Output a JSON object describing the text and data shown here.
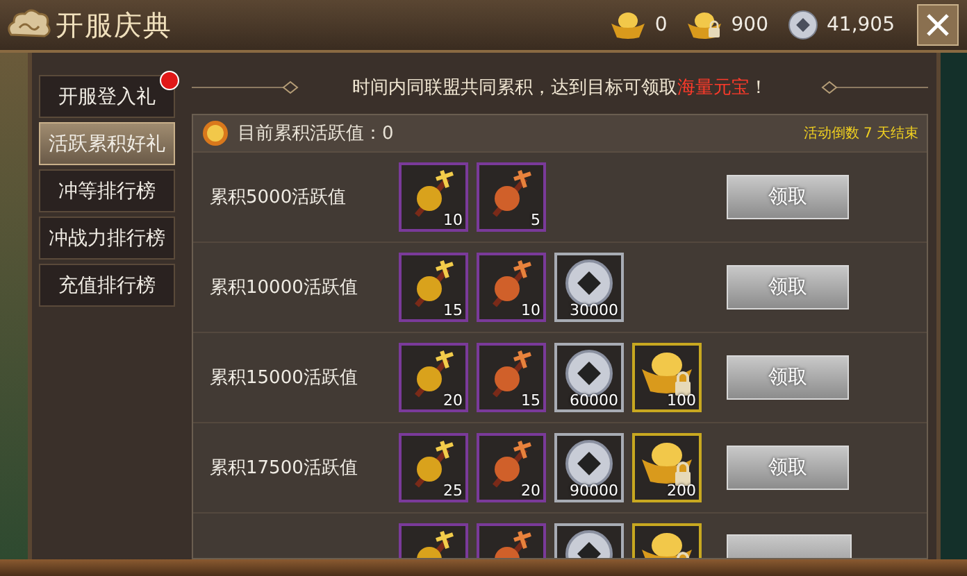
{
  "window": {
    "title": "开服庆典"
  },
  "currencies": [
    {
      "kind": "ingot",
      "amount": "0"
    },
    {
      "kind": "lockedingot",
      "amount": "900"
    },
    {
      "kind": "coin",
      "amount": "41,905"
    }
  ],
  "tabs": [
    {
      "label": "开服登入礼",
      "selected": false,
      "badge": true
    },
    {
      "label": "活跃累积好礼",
      "selected": true,
      "badge": false
    },
    {
      "label": "冲等排行榜",
      "selected": false,
      "badge": false
    },
    {
      "label": "冲战力排行榜",
      "selected": false,
      "badge": false
    },
    {
      "label": "充值排行榜",
      "selected": false,
      "badge": false
    }
  ],
  "banner": {
    "text": "时间内同联盟共同累积，达到目标可领取",
    "highlight": "海量元宝",
    "suffix": "！"
  },
  "progress": {
    "label": "目前累积活跃值：0",
    "countdown": "活动倒数 7 天结束"
  },
  "rows": [
    {
      "label": "累积5000活跃值",
      "rewards": [
        {
          "kind": "scroll",
          "count": "10"
        },
        {
          "kind": "talisman",
          "count": "5"
        }
      ],
      "button": "领取"
    },
    {
      "label": "累积10000活跃值",
      "rewards": [
        {
          "kind": "scroll",
          "count": "15"
        },
        {
          "kind": "talisman",
          "count": "10"
        },
        {
          "kind": "coin",
          "count": "30000"
        }
      ],
      "button": "领取"
    },
    {
      "label": "累积15000活跃值",
      "rewards": [
        {
          "kind": "scroll",
          "count": "20"
        },
        {
          "kind": "talisman",
          "count": "15"
        },
        {
          "kind": "coin",
          "count": "60000"
        },
        {
          "kind": "lockedingot",
          "count": "100"
        }
      ],
      "button": "领取"
    },
    {
      "label": "累积17500活跃值",
      "rewards": [
        {
          "kind": "scroll",
          "count": "25"
        },
        {
          "kind": "talisman",
          "count": "20"
        },
        {
          "kind": "coin",
          "count": "90000"
        },
        {
          "kind": "lockedingot",
          "count": "200"
        }
      ],
      "button": "领取"
    },
    {
      "rewards": [
        {
          "kind": "scroll"
        },
        {
          "kind": "talisman"
        },
        {
          "kind": "coin"
        },
        {
          "kind": "lockedingot"
        }
      ]
    }
  ]
}
